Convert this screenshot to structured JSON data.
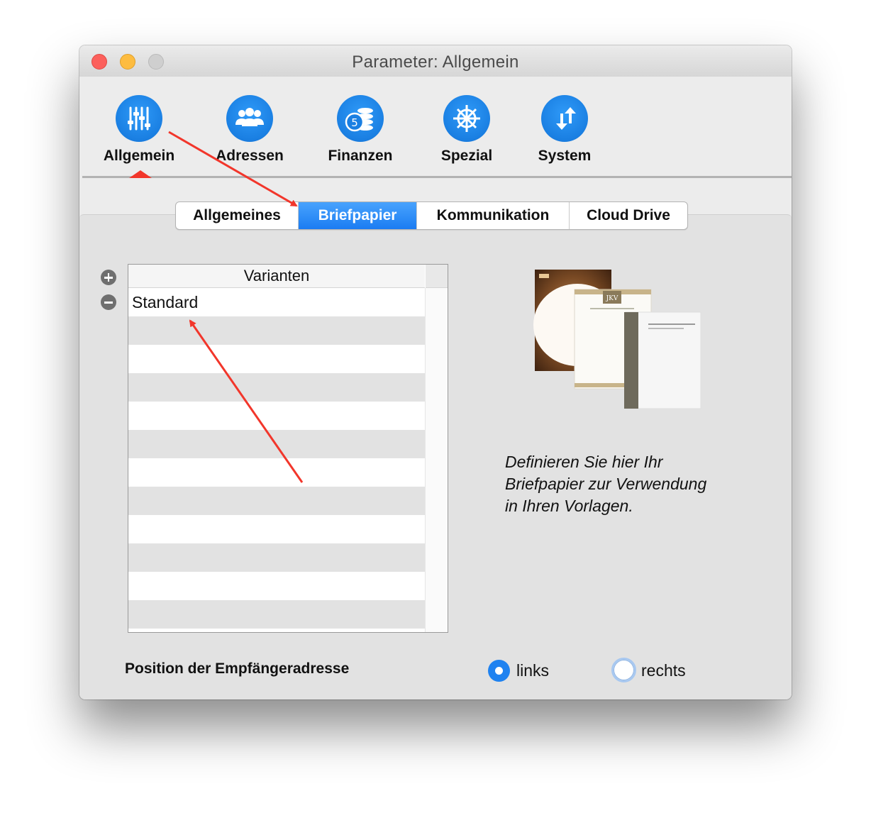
{
  "window": {
    "title": "Parameter: Allgemein"
  },
  "toolbar": {
    "items": [
      {
        "label": "Allgemein",
        "icon": "sliders-icon",
        "selected": true
      },
      {
        "label": "Adressen",
        "icon": "people-icon"
      },
      {
        "label": "Finanzen",
        "icon": "coins-icon"
      },
      {
        "label": "Spezial",
        "icon": "ship-wheel-icon"
      },
      {
        "label": "System",
        "icon": "arrows-icon"
      }
    ]
  },
  "tabs": [
    {
      "label": "Allgemeines"
    },
    {
      "label": "Briefpapier",
      "active": true
    },
    {
      "label": "Kommunikation"
    },
    {
      "label": "Cloud Drive"
    }
  ],
  "variants": {
    "header": "Varianten",
    "rows": [
      "Standard"
    ]
  },
  "preview": {
    "brand_text": "JKV"
  },
  "description": {
    "line1": "Definieren Sie hier Ihr",
    "line2": "Briefpapier zur Verwendung",
    "line3": "in Ihren Vorlagen."
  },
  "address_position": {
    "label": "Position der Empfängeradresse",
    "options": [
      "links",
      "rechts"
    ],
    "selected": "links"
  },
  "colors": {
    "accent": "#1b7cf2",
    "annotation": "#f2362b"
  }
}
